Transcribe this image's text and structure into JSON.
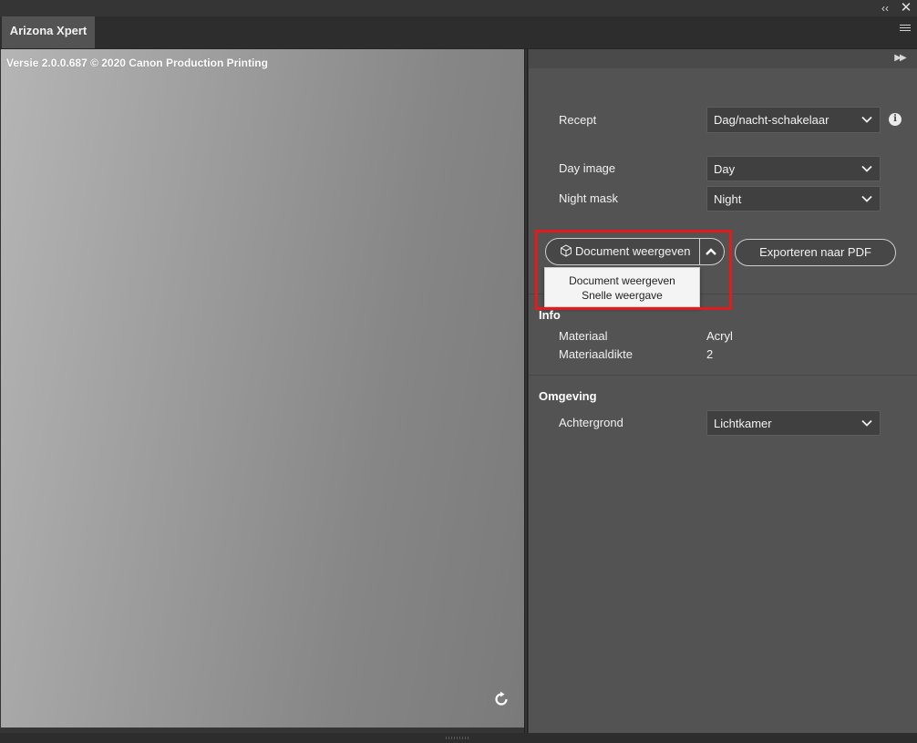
{
  "window": {
    "collapse_icon": "double-chevron-left-icon",
    "close_icon": "close-icon",
    "tab_title": "Arizona Xpert",
    "menu_icon": "hamburger-menu-icon"
  },
  "preview": {
    "version_text": "Versie 2.0.0.687 © 2020 Canon Production Printing",
    "refresh_icon": "refresh-icon"
  },
  "panel": {
    "expand_icon": "double-chevron-right-icon",
    "recipe": {
      "label": "Recept",
      "value": "Dag/nacht-schakelaar",
      "info_icon": "info-icon"
    },
    "day_image": {
      "label": "Day image",
      "value": "Day"
    },
    "night_mask": {
      "label": "Night mask",
      "value": "Night"
    },
    "view_button": {
      "label": "Document weergeven",
      "icon": "cube-icon"
    },
    "view_toggle_icon": "chevron-up-icon",
    "export_button": {
      "label": "Exporteren naar PDF"
    },
    "dropdown_items": [
      "Document weergeven",
      "Snelle weergave"
    ],
    "info": {
      "heading": "Info",
      "material_label": "Materiaal",
      "material_value": "Acryl",
      "thickness_label": "Materiaaldikte",
      "thickness_value": "2"
    },
    "environment": {
      "heading": "Omgeving",
      "background_label": "Achtergrond",
      "background_value": "Lichtkamer"
    }
  },
  "colors": {
    "highlight": "#e41b1b",
    "panel_bg": "#535353",
    "field_bg": "#404040"
  }
}
